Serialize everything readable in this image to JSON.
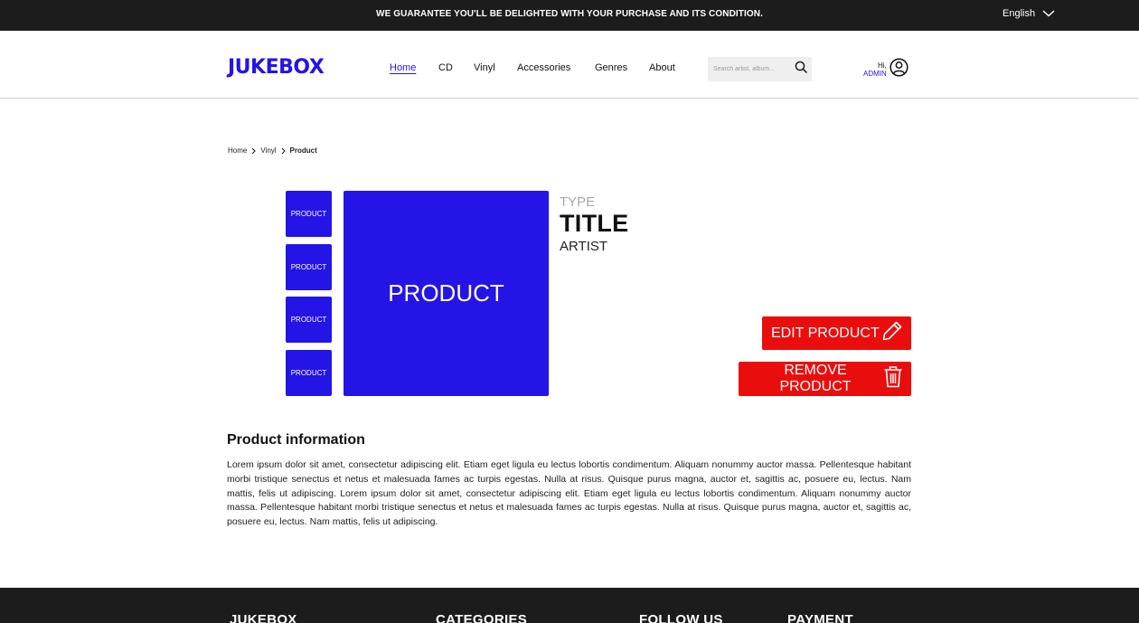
{
  "topbar": {
    "guarantee": "WE GUARANTEE YOU'LL BE DELIGHTED WITH YOUR PURCHASE AND ITS CONDITION.",
    "language": "English"
  },
  "header": {
    "logo": "JUKEBOX",
    "nav": [
      {
        "label": "Home",
        "active": true
      },
      {
        "label": "CD"
      },
      {
        "label": "Vinyl"
      },
      {
        "label": "Accessories"
      },
      {
        "label": "Genres"
      },
      {
        "label": "About"
      }
    ],
    "search_placeholder": "Search artist, album...",
    "user_greeting": "Hi,",
    "user_name": "ADMIN"
  },
  "breadcrumb": [
    "Home",
    "Vinyl",
    "Product"
  ],
  "product": {
    "thumbnails": [
      "PRODUCT",
      "PRODUCT",
      "PRODUCT",
      "PRODUCT"
    ],
    "main_image_label": "PRODUCT",
    "type": "TYPE",
    "title": "TITLE",
    "artist": "ARTIST"
  },
  "actions": {
    "edit_label": "EDIT PRODUCT",
    "remove_label": "REMOVE PRODUCT"
  },
  "info": {
    "heading": "Product information",
    "body": "Lorem ipsum dolor sit amet, consectetur adipiscing elit. Etiam eget ligula eu lectus lobortis condimentum. Aliquam nonummy auctor massa. Pellentesque habitant morbi tristique senectus et netus et malesuada fames ac turpis egestas. Nulla at risus. Quisque purus magna, auctor et, sagittis ac, posuere eu, lectus. Nam mattis, felis ut adipiscing. Lorem ipsum dolor sit amet, consectetur adipiscing elit. Etiam eget ligula eu lectus lobortis condimentum. Aliquam nonummy auctor massa. Pellentesque habitant morbi tristique senectus et netus et malesuada fames ac turpis egestas. Nulla at risus. Quisque purus magna, auctor et, sagittis ac, posuere eu, lectus. Nam mattis, felis ut adipiscing."
  },
  "footer": {
    "headings": [
      "JUKEBOX",
      "CATEGORIES",
      "FOLLOW US",
      "PAYMENT"
    ]
  },
  "colors": {
    "brand_blue": "#2414e6",
    "danger_red": "#ea0d0d",
    "dark_bar": "#1c1c1c"
  },
  "icons": {
    "language_toggle": "chevron-down-icon",
    "search": "search-icon",
    "user": "user-icon",
    "breadcrumb_separator": "chevron-right-icon",
    "edit": "pencil-icon",
    "remove": "trash-icon"
  }
}
